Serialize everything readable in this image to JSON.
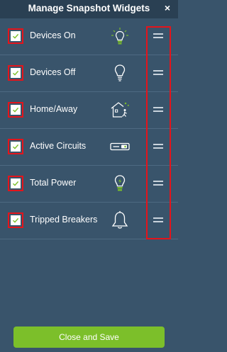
{
  "header": {
    "title": "Manage Snapshot Widgets",
    "close_label": "×"
  },
  "widgets": [
    {
      "label": "Devices On",
      "checked": true,
      "icon": "lightbulb-on-icon"
    },
    {
      "label": "Devices Off",
      "checked": true,
      "icon": "lightbulb-off-icon"
    },
    {
      "label": "Home/Away",
      "checked": true,
      "icon": "home-away-icon"
    },
    {
      "label": "Active Circuits",
      "checked": true,
      "icon": "circuit-breaker-icon"
    },
    {
      "label": "Total Power",
      "checked": true,
      "icon": "lightbulb-power-icon"
    },
    {
      "label": "Tripped Breakers",
      "checked": true,
      "icon": "bell-icon"
    }
  ],
  "footer": {
    "save_label": "Close and Save"
  },
  "colors": {
    "background": "#39546b",
    "header": "#2a4053",
    "accent_green": "#7cbf2a",
    "highlight_red": "#e4141b"
  }
}
